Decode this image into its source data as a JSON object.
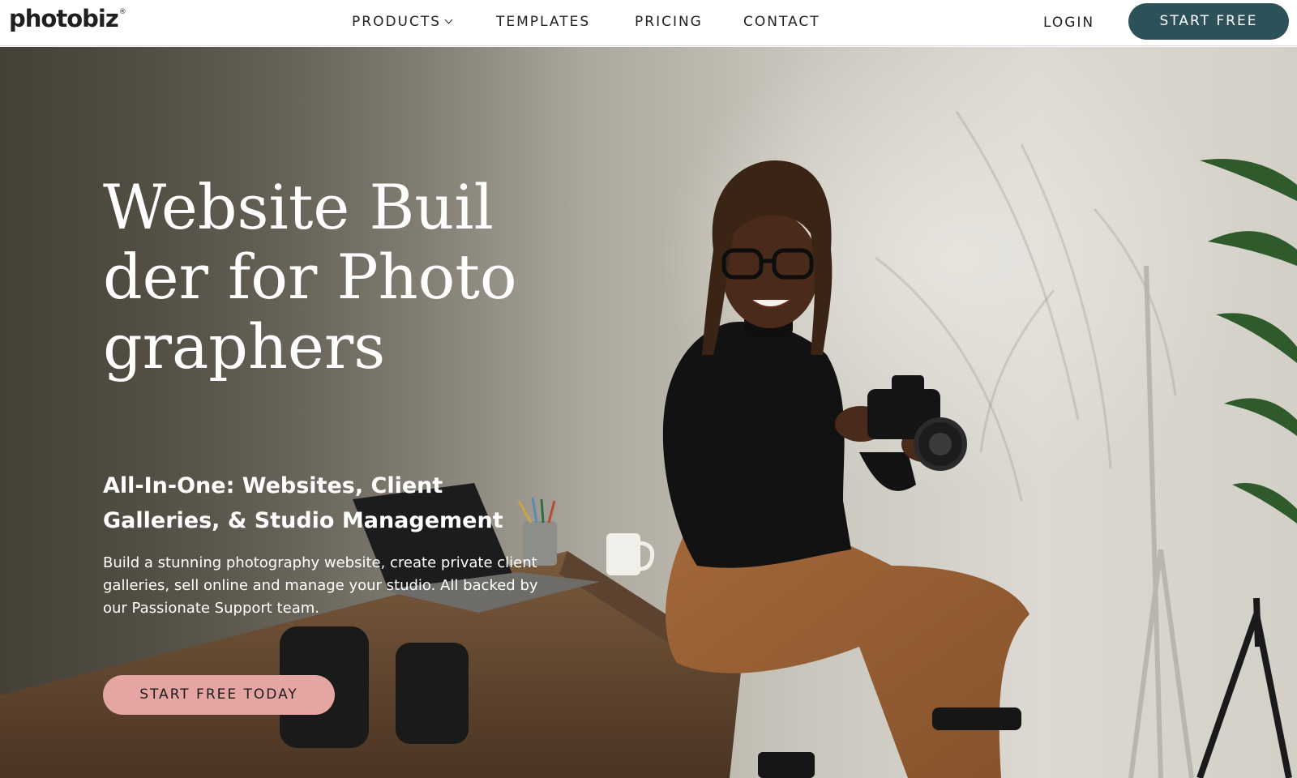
{
  "header": {
    "logo": "photobiz",
    "logo_mark": "®",
    "nav": {
      "products": "PRODUCTS",
      "templates": "TEMPLATES",
      "pricing": "PRICING",
      "contact": "CONTACT"
    },
    "login": "LOGIN",
    "start_free": "START FREE"
  },
  "hero": {
    "title": "Website Builder for Photographers",
    "subtitle": "All-In-One: Websites, Client Galleries, & Studio Management",
    "body": "Build a stunning photography website, create private client galleries, sell online and manage your studio. All backed by our Passionate Support team.",
    "cta": "START FREE TODAY"
  },
  "colors": {
    "header_cta_bg": "#2d5159",
    "hero_cta_bg": "#e5a5a2",
    "hero_text": "#ffffff",
    "nav_text": "#222222"
  },
  "icons": {
    "products_dropdown": "chevron-down-icon"
  }
}
